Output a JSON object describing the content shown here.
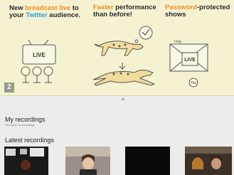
{
  "banner": {
    "slide_number": "2",
    "headline1": {
      "part1": "New ",
      "part2": "broadcast live",
      "part3": " to",
      "part4": "your ",
      "part5": "Twitter",
      "part6": " audience."
    },
    "headline2": {
      "part1": "Faster",
      "part2": " performance",
      "part3": "than before!"
    },
    "headline3": {
      "part1": "Password",
      "part2": "-protected",
      "part3": "shows"
    },
    "sketch_texts": {
      "live": "LIVE",
      "only": "Only",
      "live_box": "LIVE",
      "you": "You"
    }
  },
  "my_recordings": {
    "title": "My recordings",
    "empty_note": "You have no recordings"
  },
  "latest_recordings": {
    "title": "Latest recordings"
  },
  "colors": {
    "banner_bg": "#f5f2d2",
    "accent_orange": "#f08c1e",
    "accent_blue": "#2f9ed8"
  }
}
